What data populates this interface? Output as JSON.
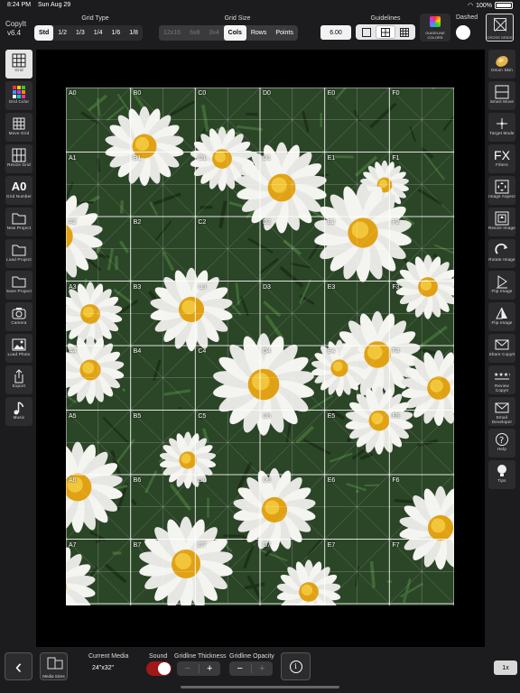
{
  "status": {
    "time": "8:24 PM",
    "date": "Sun Aug 29",
    "battery": "100%",
    "battery_level": 1.0
  },
  "app": {
    "name": "CopyIt",
    "version": "v6.4"
  },
  "grid_type": {
    "label": "Grid Type",
    "options": [
      "Std",
      "1/2",
      "1/3",
      "1/4",
      "1/6",
      "1/8"
    ],
    "selected": "Std"
  },
  "grid_size": {
    "label": "Grid Size",
    "options": [
      "12x16",
      "6x8",
      "3x4",
      "Cols",
      "Rows",
      "Points"
    ],
    "disabled": [
      "12x16",
      "6x8",
      "3x4"
    ],
    "selected": "Cols",
    "value": "6.00"
  },
  "guidelines": {
    "label": "Guidelines",
    "options": [
      "none",
      "grid",
      "fine-grid"
    ],
    "selected": "grid"
  },
  "guideline_colors": {
    "label": "GUIDELINE COLORS"
  },
  "dashed": {
    "label": "Dashed",
    "on": false
  },
  "cross_grid": {
    "label": "CROSS GRIDS"
  },
  "left_tools": [
    {
      "id": "grid",
      "label": "Grid",
      "icon": "grid-icon",
      "active": true
    },
    {
      "id": "grid-color",
      "label": "Grid Color",
      "icon": "color-grid-icon",
      "active": false
    },
    {
      "id": "move-grid",
      "label": "Move Grid",
      "icon": "move-grid-icon",
      "active": false
    },
    {
      "id": "resize-grid",
      "label": "Resize Grid",
      "icon": "resize-grid-icon",
      "active": false
    },
    {
      "id": "grid-number",
      "label": "Grid Number",
      "icon": "a0-icon",
      "glyph": "A0",
      "active": false
    },
    {
      "id": "new-project",
      "label": "New Project",
      "icon": "folder-icon",
      "active": false
    },
    {
      "id": "load-project",
      "label": "Load Project",
      "icon": "folder-icon",
      "active": false
    },
    {
      "id": "save-project",
      "label": "Save Project",
      "icon": "folder-icon",
      "active": false
    },
    {
      "id": "camera",
      "label": "Camera",
      "icon": "camera-icon",
      "active": false
    },
    {
      "id": "load-photo",
      "label": "Load Photo",
      "icon": "photo-icon",
      "active": false
    },
    {
      "id": "export",
      "label": "Export",
      "icon": "share-icon",
      "active": false
    },
    {
      "id": "music",
      "label": "Music",
      "icon": "music-icon",
      "active": false
    }
  ],
  "right_tools": [
    {
      "id": "onion-skin",
      "label": "Onion Skin",
      "icon": "onion-icon"
    },
    {
      "id": "smart-move",
      "label": "Smart Move",
      "icon": "smart-move-icon"
    },
    {
      "id": "target-mode",
      "label": "Target Mode",
      "icon": "target-icon"
    },
    {
      "id": "filters",
      "label": "Filters",
      "icon": "fx-icon",
      "glyph": "FX"
    },
    {
      "id": "image-aspect",
      "label": "Image Aspect",
      "icon": "aspect-icon"
    },
    {
      "id": "resize-image",
      "label": "Resize Image",
      "icon": "resize-image-icon"
    },
    {
      "id": "rotate-image",
      "label": "Rotate Image",
      "icon": "rotate-icon"
    },
    {
      "id": "flip-image",
      "label": "Flip Image",
      "icon": "flip-icon"
    },
    {
      "id": "flip-image-2",
      "label": "Flip Image",
      "icon": "flip-vertical-icon"
    },
    {
      "id": "share-copyit",
      "label": "Share CopyIt",
      "icon": "mail-icon"
    },
    {
      "id": "review-copyit",
      "label": "Review CopyIt",
      "icon": "stars-icon"
    },
    {
      "id": "email-developer",
      "label": "Email Developer",
      "icon": "mail-icon"
    },
    {
      "id": "help",
      "label": "Help",
      "icon": "help-icon"
    },
    {
      "id": "tips",
      "label": "Tips",
      "icon": "bulb-icon"
    }
  ],
  "grid": {
    "columns": [
      "A",
      "B",
      "C",
      "D",
      "E",
      "F"
    ],
    "rows": [
      0,
      1,
      2,
      3,
      4,
      5,
      6,
      7
    ],
    "line_color": "#ffffff"
  },
  "bottom": {
    "back_icon": "chevron-left-icon",
    "media_sizes_label": "Media Sizes",
    "current_media_label": "Current Media",
    "current_media_value": "24\"x32\"",
    "sound_label": "Sound",
    "sound_on": true,
    "thickness_label": "Gridline Thickness",
    "opacity_label": "Gridline Opacity",
    "info_icon": "info-icon",
    "zoom": "1x"
  },
  "colors": {
    "accent_red": "#a01818",
    "background": "#1c1c1e",
    "canvas": "#000000"
  }
}
